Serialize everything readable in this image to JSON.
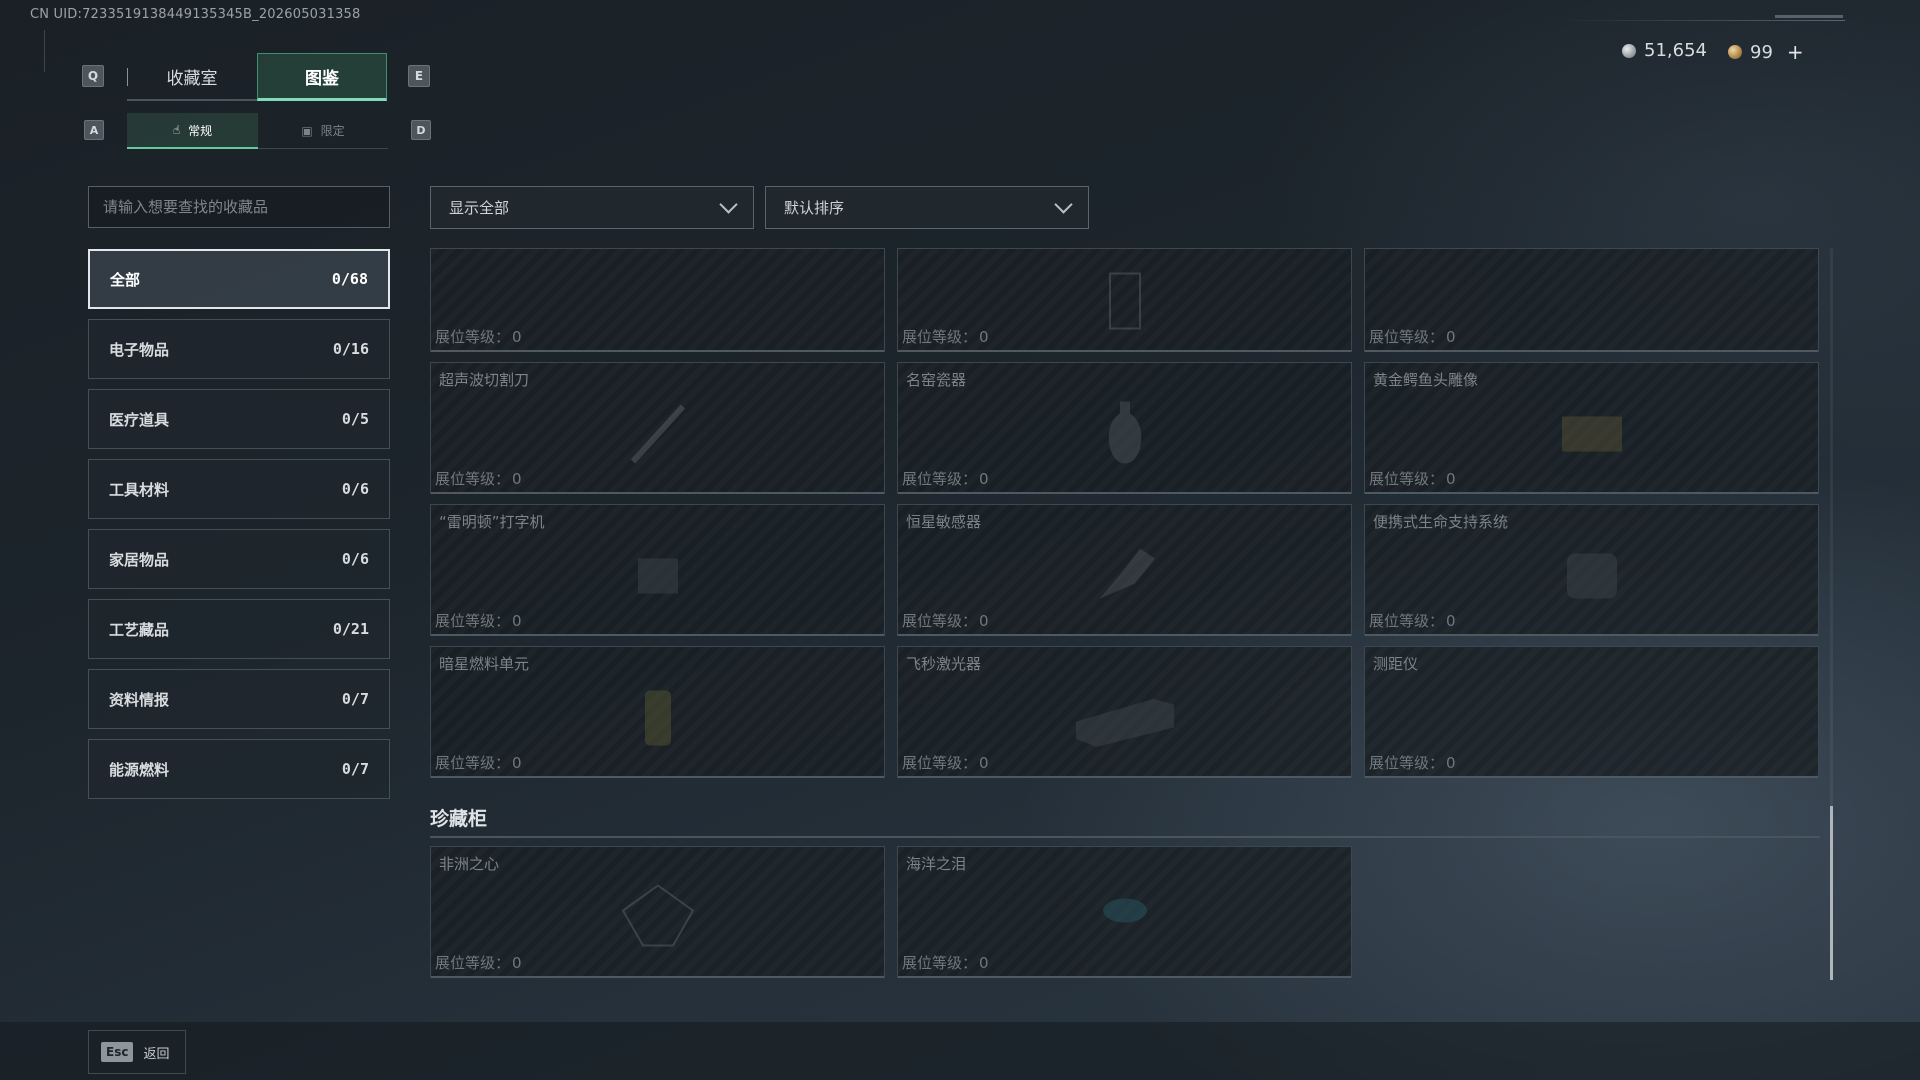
{
  "uid": "CN UID:7233519138449135345B_202605031358",
  "header": {
    "key_prev_tab": "Q",
    "key_next_tab": "E",
    "tabs": [
      {
        "label": "收藏室",
        "active": false
      },
      {
        "label": "图鉴",
        "active": true
      }
    ],
    "key_prev_subtab": "A",
    "key_next_subtab": "D",
    "subtabs": [
      {
        "label": "常规",
        "icon": "hand-icon",
        "active": true
      },
      {
        "label": "限定",
        "icon": "box-icon",
        "active": false
      }
    ]
  },
  "currency": {
    "silver": "51,654",
    "gold": "99",
    "plus": "+"
  },
  "search": {
    "placeholder": "请输入想要查找的收藏品"
  },
  "categories": [
    {
      "label": "全部",
      "count": "0/68",
      "selected": true
    },
    {
      "label": "电子物品",
      "count": "0/16"
    },
    {
      "label": "医疗道具",
      "count": "0/5"
    },
    {
      "label": "工具材料",
      "count": "0/6"
    },
    {
      "label": "家居物品",
      "count": "0/6"
    },
    {
      "label": "工艺藏品",
      "count": "0/21"
    },
    {
      "label": "资料情报",
      "count": "0/7"
    },
    {
      "label": "能源燃料",
      "count": "0/7"
    }
  ],
  "filters": {
    "show": "显示全部",
    "sort": "默认排序"
  },
  "level_label": "展位等级：",
  "items": [
    {
      "name": "",
      "level": "0"
    },
    {
      "name": "",
      "level": "0"
    },
    {
      "name": "",
      "level": "0"
    },
    {
      "name": "超声波切割刀",
      "level": "0"
    },
    {
      "name": "名窑瓷器",
      "level": "0"
    },
    {
      "name": "黄金鳄鱼头雕像",
      "level": "0"
    },
    {
      "name": "“雷明顿”打字机",
      "level": "0"
    },
    {
      "name": "恒星敏感器",
      "level": "0"
    },
    {
      "name": "便携式生命支持系统",
      "level": "0"
    },
    {
      "name": "暗星燃料单元",
      "level": "0"
    },
    {
      "name": "飞秒激光器",
      "level": "0"
    },
    {
      "name": "测距仪",
      "level": "0"
    }
  ],
  "showcase": {
    "title": "珍藏柜",
    "items": [
      {
        "name": "非洲之心",
        "level": "0"
      },
      {
        "name": "海洋之泪",
        "level": "0"
      }
    ]
  },
  "footer": {
    "esc_key": "Esc",
    "back_label": "返回"
  },
  "colors": {
    "accent": "#7fdcb6",
    "panel": "#20272d",
    "text": "#c9cfd3"
  }
}
